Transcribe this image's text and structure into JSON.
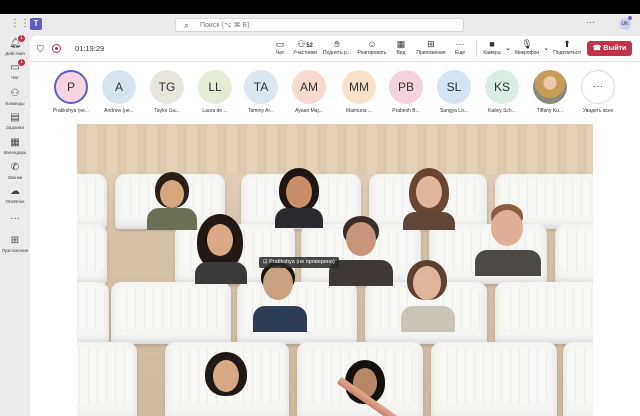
{
  "titlebar": {
    "search_placeholder": "Поиск (⌥ ⌘ E)",
    "account_initials": "UK"
  },
  "sidebar": {
    "items": [
      {
        "label": "Действия",
        "icon": "bell-icon",
        "badge": "1"
      },
      {
        "label": "Чат",
        "icon": "chat-icon",
        "badge": "1"
      },
      {
        "label": "Команды",
        "icon": "teams-icon",
        "badge": ""
      },
      {
        "label": "Задания",
        "icon": "assignments-icon",
        "badge": ""
      },
      {
        "label": "Календарь",
        "icon": "calendar-icon",
        "badge": ""
      },
      {
        "label": "Звонки",
        "icon": "phone-icon",
        "badge": ""
      },
      {
        "label": "OneDrive",
        "icon": "cloud-icon",
        "badge": ""
      },
      {
        "label": "",
        "icon": "more-icon",
        "badge": ""
      },
      {
        "label": "Приложения",
        "icon": "apps-icon",
        "badge": ""
      }
    ]
  },
  "meeting": {
    "timer": "01:19:29",
    "tools": [
      {
        "label": "Чат",
        "icon": "chat-icon",
        "count": ""
      },
      {
        "label": "Участники",
        "icon": "people-icon",
        "count": "52"
      },
      {
        "label": "Поднять р...",
        "icon": "raise-hand-icon",
        "count": ""
      },
      {
        "label": "Реагировать",
        "icon": "smile-icon",
        "count": ""
      },
      {
        "label": "Вид",
        "icon": "view-icon",
        "count": ""
      },
      {
        "label": "Приложения",
        "icon": "add-app-icon",
        "count": ""
      },
      {
        "label": "Еще",
        "icon": "more-icon",
        "count": ""
      },
      {
        "label": "Камера",
        "icon": "camera-icon",
        "count": ""
      },
      {
        "label": "Микрофон",
        "icon": "mic-icon",
        "count": ""
      },
      {
        "label": "Поделиться",
        "icon": "share-icon",
        "count": ""
      }
    ],
    "leave_label": "Выйти"
  },
  "roster": [
    {
      "initials": "P",
      "name": "Pratikshya (не...",
      "color": "#f6d5e1",
      "selected": true
    },
    {
      "initials": "A",
      "name": "Andrew (не...",
      "color": "#d7e4ee"
    },
    {
      "initials": "TG",
      "name": "Taylor Ga...",
      "color": "#e6e6df"
    },
    {
      "initials": "LL",
      "name": "Laura de ...",
      "color": "#e4ecd6"
    },
    {
      "initials": "TA",
      "name": "Tammy Ar...",
      "color": "#dbe6ee"
    },
    {
      "initials": "AM",
      "name": "Ayaan Maj...",
      "color": "#f7d9cf"
    },
    {
      "initials": "MM",
      "name": "Maimuna ...",
      "color": "#f5e2c9"
    },
    {
      "initials": "PB",
      "name": "Prabesh B...",
      "color": "#f3d3dc"
    },
    {
      "initials": "SL",
      "name": "Sangya Lo...",
      "color": "#d5e4f2"
    },
    {
      "initials": "KS",
      "name": "Kailey Sch...",
      "color": "#d9ede4"
    },
    {
      "initials": "",
      "name": "Tiffany Ku...",
      "color": "#caa45f",
      "photo": true
    },
    {
      "initials": "···",
      "name": "Увидеть всех",
      "color": "#ffffff",
      "more": true
    }
  ],
  "stage": {
    "spotlight_name": "Pratikshya (не проверено)"
  }
}
